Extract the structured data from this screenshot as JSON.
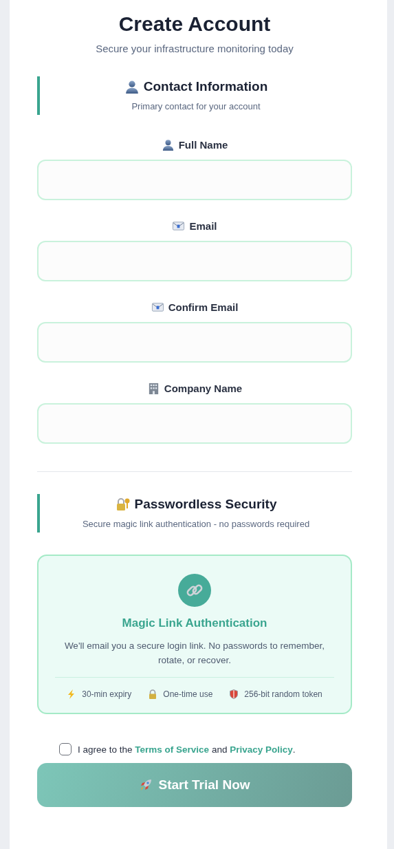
{
  "header": {
    "title": "Create Account",
    "subtitle": "Secure your infrastructure monitoring today"
  },
  "contact": {
    "title": "Contact Information",
    "subtitle": "Primary contact for your account",
    "fields": [
      {
        "label": "Full Name"
      },
      {
        "label": "Email"
      },
      {
        "label": "Confirm Email"
      },
      {
        "label": "Company Name"
      }
    ]
  },
  "security": {
    "title": "Passwordless Security",
    "subtitle": "Secure magic link authentication - no passwords required"
  },
  "magic_card": {
    "title": "Magic Link Authentication",
    "description": "We'll email you a secure login link. No passwords to remember, rotate, or recover.",
    "features": [
      {
        "text": "30-min expiry"
      },
      {
        "text": "One-time use"
      },
      {
        "text": "256-bit random token"
      }
    ]
  },
  "agreement": {
    "checked": false,
    "parts": [
      {
        "kind": "text",
        "text": "I agree to the "
      },
      {
        "kind": "link",
        "text": "Terms of Service"
      },
      {
        "kind": "text",
        "text": " and "
      },
      {
        "kind": "link",
        "text": "Privacy Policy"
      },
      {
        "kind": "text",
        "text": "."
      }
    ]
  },
  "submit": {
    "label": "Start Trial Now"
  }
}
